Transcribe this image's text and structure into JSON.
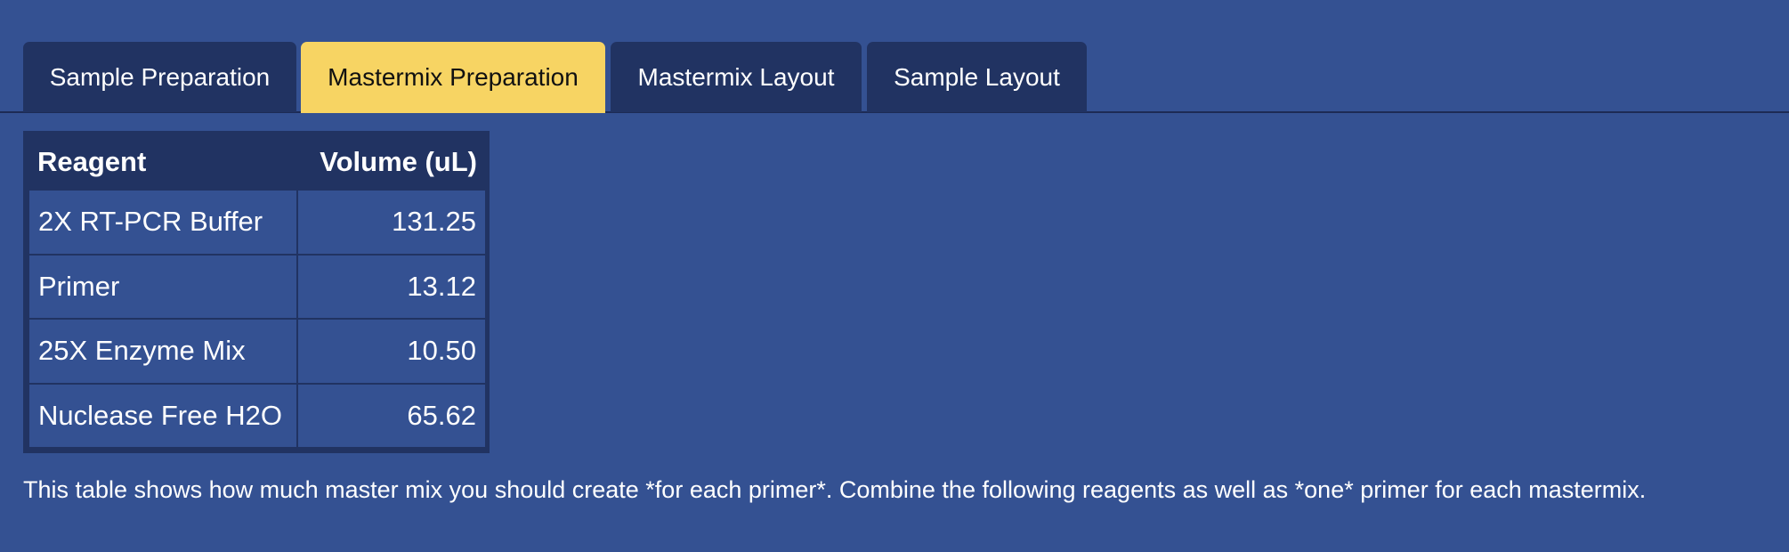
{
  "tabs": [
    {
      "label": "Sample Preparation",
      "active": false
    },
    {
      "label": "Mastermix Preparation",
      "active": true
    },
    {
      "label": "Mastermix Layout",
      "active": false
    },
    {
      "label": "Sample Layout",
      "active": false
    }
  ],
  "table": {
    "headers": [
      "Reagent",
      "Volume (uL)"
    ],
    "rows": [
      [
        "2X RT-PCR Buffer",
        "131.25"
      ],
      [
        "Primer",
        "13.12"
      ],
      [
        "25X Enzyme Mix",
        "10.50"
      ],
      [
        "Nuclease Free H2O",
        "65.62"
      ]
    ]
  },
  "note": "This table shows how much master mix you should create *for each primer*. Combine the following reagents as well as *one* primer for each mastermix.",
  "colors": {
    "background": "#345192",
    "tab_inactive": "#213362",
    "tab_active": "#f7d463",
    "table_border": "#213362"
  }
}
